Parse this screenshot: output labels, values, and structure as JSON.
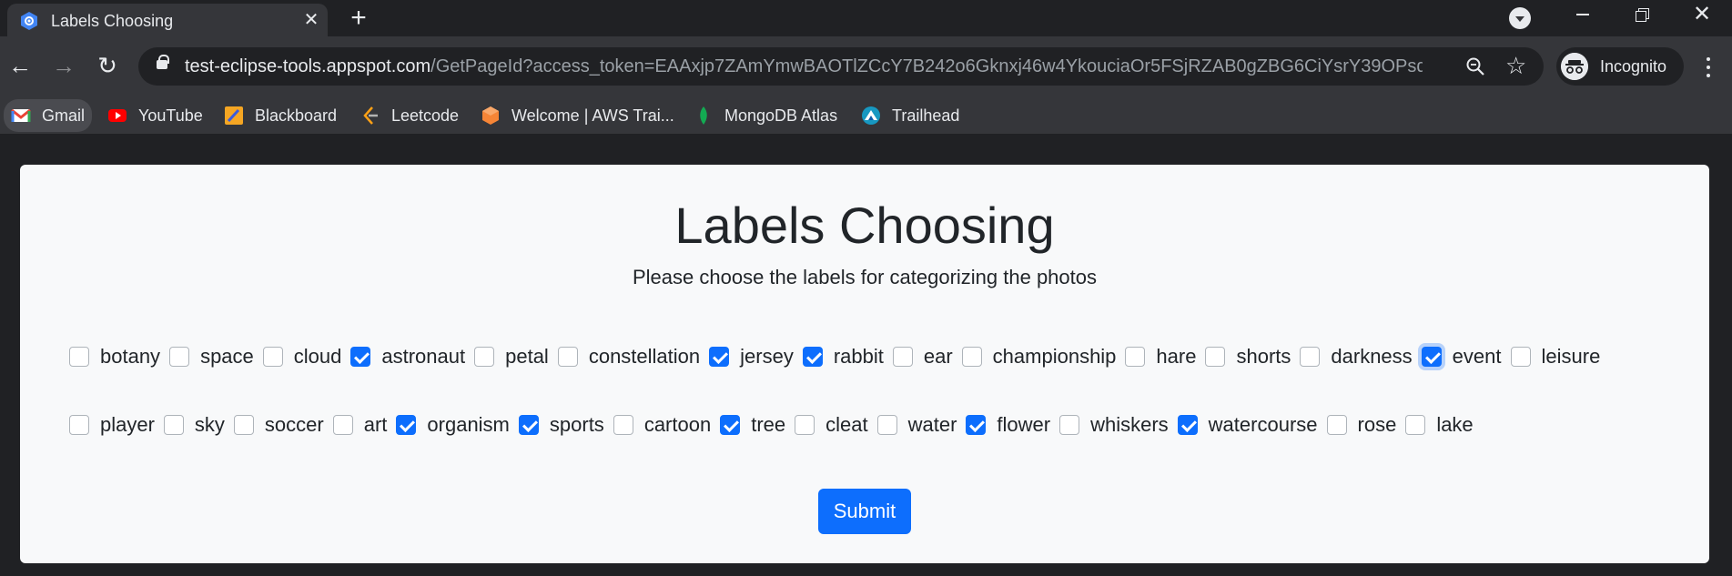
{
  "browser": {
    "tab_title": "Labels Choosing",
    "tab_close": "✕",
    "new_tab": "+",
    "url_host": "test-eclipse-tools.appspot.com",
    "url_path": "/GetPageId?access_token=EAAxjp7ZAmYmwBAOTlZCcY7B242o6Gknxj46w4YkouciaOr5FSjRZAB0gZBG6CiYsrY39OPsd...",
    "incognito_label": "Incognito",
    "back_glyph": "←",
    "forward_glyph": "→",
    "reload_glyph": "↻",
    "star_glyph": "☆",
    "window_close": "✕"
  },
  "bookmarks": [
    {
      "label": "Gmail",
      "icon": "gmail-icon",
      "color": "#ea4335"
    },
    {
      "label": "YouTube",
      "icon": "youtube-icon",
      "color": "#ff0000"
    },
    {
      "label": "Blackboard",
      "icon": "blackboard-icon",
      "color": "#f5a623"
    },
    {
      "label": "Leetcode",
      "icon": "leetcode-icon",
      "color": "#ffa116"
    },
    {
      "label": "Welcome | AWS Trai...",
      "icon": "aws-icon",
      "color": "#f68536"
    },
    {
      "label": "MongoDB Atlas",
      "icon": "mongodb-icon",
      "color": "#13aa52"
    },
    {
      "label": "Trailhead",
      "icon": "trailhead-icon",
      "color": "#1798c1"
    }
  ],
  "page": {
    "title": "Labels Choosing",
    "subtitle": "Please choose the labels for categorizing the photos",
    "submit_label": "Submit",
    "accent_color": "#0d6efd"
  },
  "labels_row1": [
    {
      "label": "botany",
      "checked": false
    },
    {
      "label": "space",
      "checked": false
    },
    {
      "label": "cloud",
      "checked": false
    },
    {
      "label": "astronaut",
      "checked": true
    },
    {
      "label": "petal",
      "checked": false
    },
    {
      "label": "constellation",
      "checked": false
    },
    {
      "label": "jersey",
      "checked": true
    },
    {
      "label": "rabbit",
      "checked": true
    },
    {
      "label": "ear",
      "checked": false
    },
    {
      "label": "championship",
      "checked": false
    },
    {
      "label": "hare",
      "checked": false
    },
    {
      "label": "shorts",
      "checked": false
    },
    {
      "label": "darkness",
      "checked": false
    },
    {
      "label": "event",
      "checked": true,
      "focused": true
    },
    {
      "label": "leisure",
      "checked": false
    }
  ],
  "labels_row2": [
    {
      "label": "player",
      "checked": false
    },
    {
      "label": "sky",
      "checked": false
    },
    {
      "label": "soccer",
      "checked": false
    },
    {
      "label": "art",
      "checked": false
    },
    {
      "label": "organism",
      "checked": true
    },
    {
      "label": "sports",
      "checked": true
    },
    {
      "label": "cartoon",
      "checked": false
    },
    {
      "label": "tree",
      "checked": true
    },
    {
      "label": "cleat",
      "checked": false
    },
    {
      "label": "water",
      "checked": false
    },
    {
      "label": "flower",
      "checked": true
    },
    {
      "label": "whiskers",
      "checked": false
    },
    {
      "label": "watercourse",
      "checked": true
    },
    {
      "label": "rose",
      "checked": false
    },
    {
      "label": "lake",
      "checked": false
    }
  ]
}
